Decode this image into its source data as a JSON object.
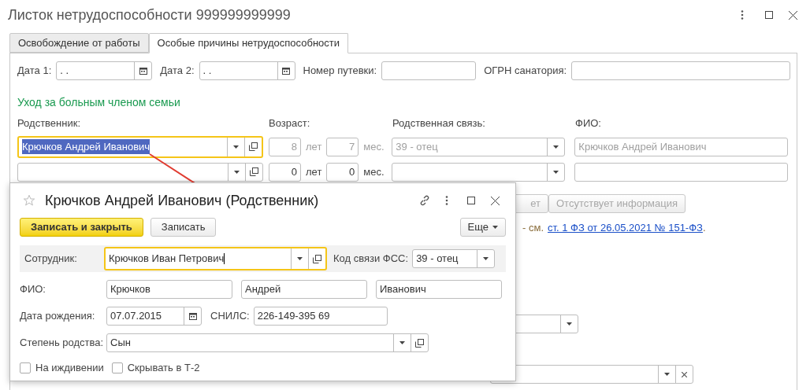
{
  "window": {
    "title": "Листок нетрудоспособности 999999999999"
  },
  "tabs": [
    {
      "label": "Освобождение от работы",
      "selected": false
    },
    {
      "label": "Особые причины нетрудоспособности",
      "selected": true
    }
  ],
  "voucher": {
    "date1_label": "Дата 1:",
    "date1_value": ". .",
    "date2_label": "Дата 2:",
    "date2_value": ". .",
    "number_label": "Номер путевки:",
    "ogrn_label": "ОГРН санатория:"
  },
  "care": {
    "heading": "Уход за больным членом семьи",
    "relative_label": "Родственник:",
    "age_label": "Возраст:",
    "relation_label": "Родственная связь:",
    "fio_label": "ФИО:",
    "rows": [
      {
        "relative": "Крючков Андрей Иванович",
        "focused": true,
        "disabled": true,
        "years": "8",
        "years_unit": "лет",
        "months": "7",
        "months_unit": "мес.",
        "relation": "39 - отец",
        "fio": "Крючков Андрей Иванович"
      },
      {
        "focused": false,
        "disabled": false,
        "years": "0",
        "years_unit": "лет",
        "months": "0",
        "months_unit": "мес."
      }
    ]
  },
  "info_buttons": [
    {
      "label": "ет",
      "disabled": true
    },
    {
      "label": "Отсутствует информация",
      "disabled": true
    }
  ],
  "note": {
    "prefix": "- см.",
    "link": "ст. 1 ФЗ от 26.05.2021 № 151-ФЗ",
    "suffix": "."
  },
  "dialog": {
    "title": "Крючков Андрей Иванович (Родственник)",
    "starred": false,
    "buttons": [
      {
        "label": "Записать и закрыть",
        "kind": "primary"
      },
      {
        "label": "Записать",
        "kind": "default"
      }
    ],
    "more": "Еще",
    "employee": {
      "label": "Сотрудник:",
      "value": "Крючков Иван Петрович",
      "focused": true
    },
    "fss": {
      "label": "Код связи ФСС:",
      "value": "39 - отец"
    },
    "fio": {
      "label": "ФИО:",
      "values": [
        "Крючков",
        "Андрей",
        "Иванович"
      ]
    },
    "birth": {
      "label": "Дата рождения:",
      "value": "07.07.2015"
    },
    "snils": {
      "label": "СНИЛС:",
      "value": "226-149-395 69"
    },
    "degree": {
      "label": "Степень родства:",
      "value": "Сын"
    },
    "checkboxes": [
      {
        "label": "На иждивении",
        "checked": false
      },
      {
        "label": "Скрывать в Т-2",
        "checked": false
      }
    ]
  }
}
